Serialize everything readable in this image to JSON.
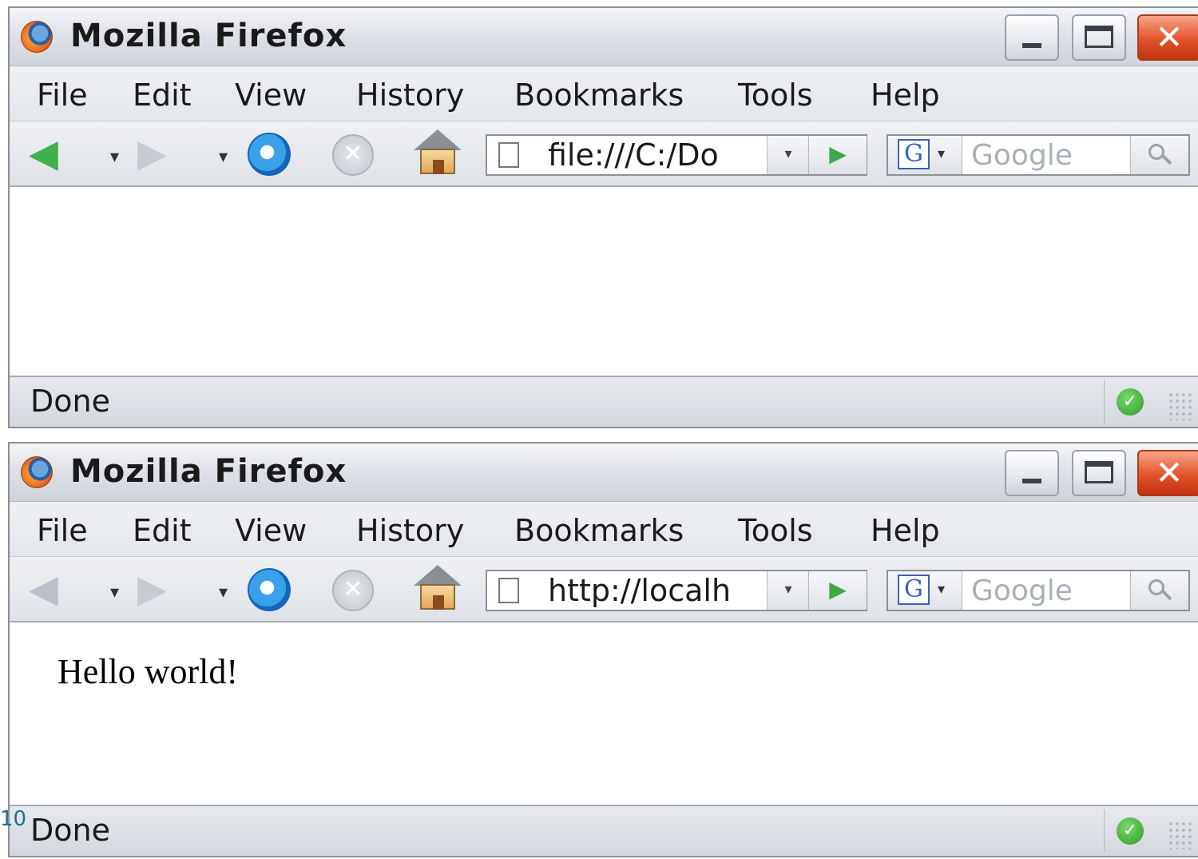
{
  "windows": [
    {
      "title": "Mozilla Firefox",
      "menu": [
        "File",
        "Edit",
        "View",
        "History",
        "Bookmarks",
        "Tools",
        "Help"
      ],
      "url": "file:///C:/Do",
      "search_placeholder": "Google",
      "content_text": "",
      "status": "Done",
      "back_enabled": true
    },
    {
      "title": "Mozilla Firefox",
      "menu": [
        "File",
        "Edit",
        "View",
        "History",
        "Bookmarks",
        "Tools",
        "Help"
      ],
      "url": "http://localh",
      "search_placeholder": "Google",
      "content_text": "Hello world!",
      "status": "Done",
      "back_enabled": false
    }
  ],
  "engine_letter": "G",
  "slide_number": "10",
  "colors": {
    "titlebar": "#dfe2e8",
    "close_button": "#e2532a",
    "back_arrow": "#3fb04a",
    "go_arrow": "#3fa848",
    "status_ok": "#2e9a2a"
  }
}
